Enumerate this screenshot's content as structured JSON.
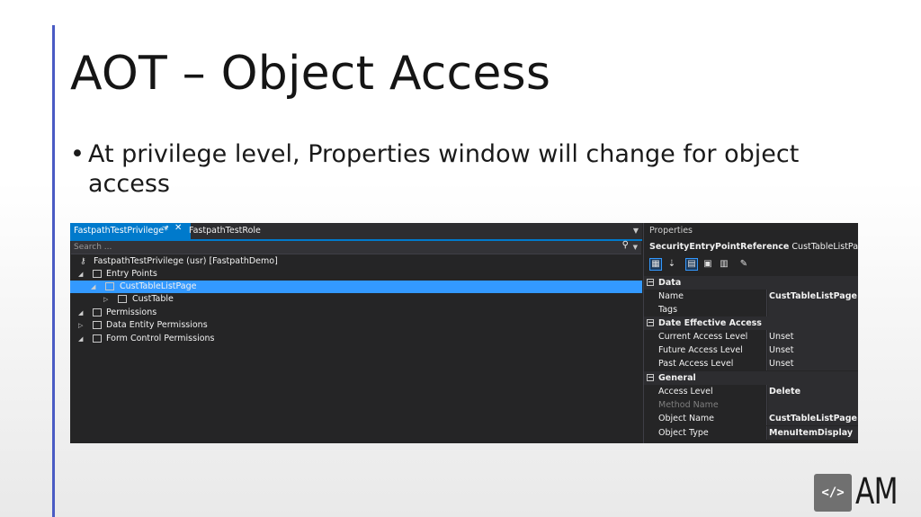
{
  "slide": {
    "title": "AOT – Object Access",
    "bullet": "At privilege level, Properties window will change for object access"
  },
  "editor": {
    "tabs": [
      {
        "label": "FastpathTestPrivilege*",
        "active": true
      },
      {
        "label": "FastpathTestRole",
        "active": false
      }
    ],
    "search_placeholder": "Search ...",
    "tree": [
      {
        "label": "FastpathTestPrivilege (usr) [FastpathDemo]",
        "icon": "key-icon"
      },
      {
        "label": "Entry Points",
        "icon": "entry-points-icon",
        "expanded": true
      },
      {
        "label": "CustTableListPage",
        "icon": "menu-item-icon",
        "expanded": true,
        "selected": true
      },
      {
        "label": "CustTable",
        "icon": "table-icon",
        "expanded": false
      },
      {
        "label": "Permissions",
        "icon": "permissions-icon",
        "expanded": true
      },
      {
        "label": "Data Entity Permissions",
        "icon": "data-entity-icon",
        "expanded": false
      },
      {
        "label": "Form Control Permissions",
        "icon": "form-icon",
        "expanded": true
      }
    ]
  },
  "properties": {
    "header": "Properties",
    "object_type": "SecurityEntryPointReference",
    "object_name": "CustTableListPage",
    "toolbar_icons": [
      "categorized-icon",
      "alphabetical-icon",
      "properties-icon",
      "events-icon",
      "property-pages-icon",
      "wrench-icon"
    ],
    "categories": [
      {
        "name": "Data",
        "rows": [
          {
            "name": "Name",
            "value": "CustTableListPage",
            "bold": true
          },
          {
            "name": "Tags",
            "value": ""
          }
        ]
      },
      {
        "name": "Date Effective Access",
        "rows": [
          {
            "name": "Current Access Level",
            "value": "Unset"
          },
          {
            "name": "Future Access Level",
            "value": "Unset"
          },
          {
            "name": "Past Access Level",
            "value": "Unset"
          }
        ]
      },
      {
        "name": "General",
        "rows": [
          {
            "name": "Access Level",
            "value": "Delete",
            "bold": true
          },
          {
            "name": "Method Name",
            "value": "",
            "dim": true
          },
          {
            "name": "Object Name",
            "value": "CustTableListPage",
            "bold": true
          },
          {
            "name": "Object Type",
            "value": "MenuItemDisplay",
            "bold": true
          }
        ]
      }
    ]
  },
  "logo": {
    "icon_glyph": "</>",
    "text": "AM"
  },
  "colors": {
    "accent_bar": "#4a5bc4",
    "selection": "#3399ff",
    "active_tab": "#007acc",
    "ide_background": "#252526"
  }
}
